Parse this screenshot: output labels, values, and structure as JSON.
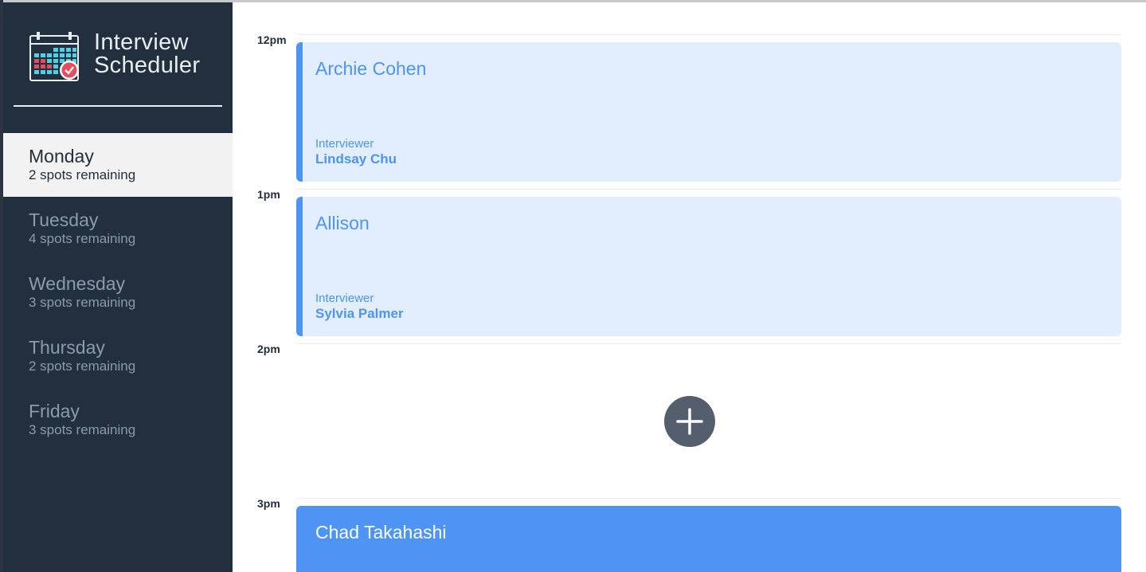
{
  "app": {
    "title_line1": "Interview",
    "title_line2": "Scheduler"
  },
  "colors": {
    "sidebar": "#222f3e",
    "accent": "#4d94f5",
    "appointment_bg": "#e2eefd",
    "add_button": "#555e6c"
  },
  "days": [
    {
      "name": "Monday",
      "spots": "2 spots remaining",
      "selected": true
    },
    {
      "name": "Tuesday",
      "spots": "4 spots remaining",
      "selected": false
    },
    {
      "name": "Wednesday",
      "spots": "3 spots remaining",
      "selected": false
    },
    {
      "name": "Thursday",
      "spots": "2 spots remaining",
      "selected": false
    },
    {
      "name": "Friday",
      "spots": "3 spots remaining",
      "selected": false
    }
  ],
  "schedule": {
    "slots": [
      {
        "time": "12pm",
        "student": "Archie Cohen",
        "interviewer_label": "Interviewer",
        "interviewer": "Lindsay Chu"
      },
      {
        "time": "1pm",
        "student": "Allison",
        "interviewer_label": "Interviewer",
        "interviewer": "Sylvia Palmer"
      },
      {
        "time": "2pm",
        "empty": true,
        "add_icon": "plus-icon"
      },
      {
        "time": "3pm",
        "student": "Chad Takahashi"
      }
    ]
  }
}
